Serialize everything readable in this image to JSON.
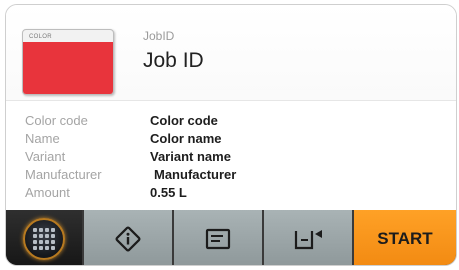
{
  "swatch": {
    "label": "COLOR",
    "color": "#e8343c"
  },
  "job": {
    "label": "JobID",
    "value": "Job ID"
  },
  "details": [
    {
      "label": "Color code",
      "value": "Color code"
    },
    {
      "label": "Name",
      "value": "Color name"
    },
    {
      "label": "Variant",
      "value": "Variant name"
    },
    {
      "label": "Manufacturer",
      "value": "Manufacturer"
    },
    {
      "label": "Amount",
      "value": "0.55 L"
    }
  ],
  "toolbar": {
    "home_icon": "grid-menu-icon",
    "info_icon": "info-diamond-icon",
    "list_icon": "document-list-icon",
    "can_icon": "paint-can-icon",
    "start_label": "START"
  },
  "colors": {
    "accent_orange": "#f28a12",
    "toolbar_gray": "#9aa4a6",
    "toolbar_dark": "#1e1e1e"
  }
}
